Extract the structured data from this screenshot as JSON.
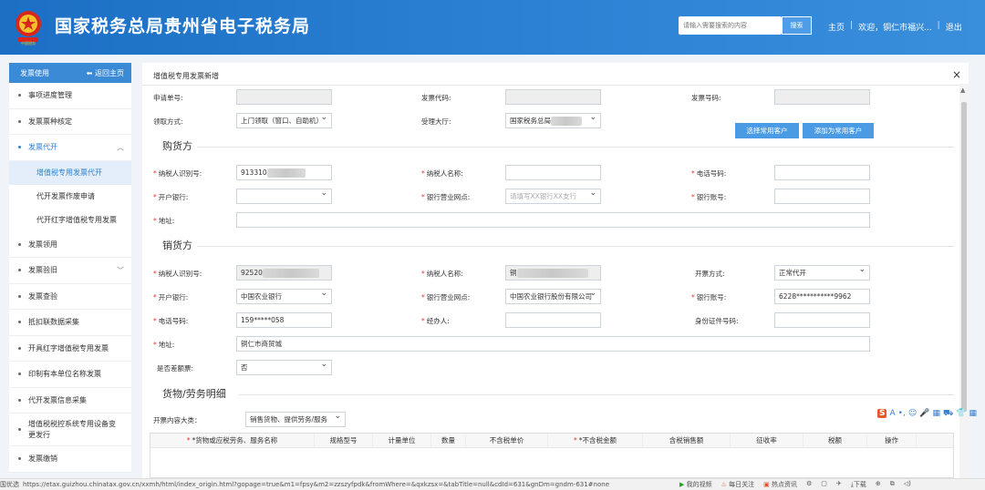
{
  "header": {
    "title": "国家税务总局贵州省电子税务局",
    "search_placeholder": "请输入需要搜索的内容",
    "search_button": "搜索",
    "home": "主页",
    "welcome": "欢迎，铜仁市福兴...",
    "logout": "退出",
    "separator": "|",
    "brand_color": "#2b82d4"
  },
  "sidebar": {
    "title": "发票使用",
    "back": "返回主页",
    "items": [
      {
        "label": "事项进度管理"
      },
      {
        "label": "发票票种核定"
      },
      {
        "label": "发票代开",
        "expanded": true
      },
      {
        "label": "发票领用"
      },
      {
        "label": "发票验旧"
      },
      {
        "label": "发票查验"
      },
      {
        "label": "抵扣联数据采集"
      },
      {
        "label": "开具红字增值税专用发票"
      },
      {
        "label": "印制有本单位名称发票"
      },
      {
        "label": "代开发票信息采集"
      },
      {
        "label": "增值税税控系统专用设备变更发行"
      },
      {
        "label": "发票缴销"
      }
    ],
    "subitems": [
      {
        "label": "增值税专用发票代开"
      },
      {
        "label": "代开发票作废申请"
      },
      {
        "label": "代开红字增值税专用发票"
      }
    ]
  },
  "form": {
    "page_title": "增值税专用发票新增",
    "close": "×",
    "top": {
      "apply_no_label": "申请单号:",
      "invoice_code_label": "发票代码:",
      "invoice_no_label": "发票号码:",
      "collect_method_label": "领取方式:",
      "collect_method_value": "上门领取（窗口、自助机）",
      "hall_label": "受理大厅:",
      "hall_value": "国家税务总局",
      "select_customer_btn": "选择常用客户",
      "add_customer_btn": "添加为常用客户"
    },
    "buyer": {
      "section": "购货方",
      "taxpayer_id_label": "纳税人识别号:",
      "taxpayer_id_value": "913310",
      "taxpayer_name_label": "纳税人名称:",
      "phone_label": "电话号码:",
      "bank_label": "开户银行:",
      "bank_branch_label": "银行营业网点:",
      "bank_branch_placeholder": "请填写XX银行XX支行",
      "account_label": "银行账号:",
      "address_label": "地址:"
    },
    "seller": {
      "section": "销货方",
      "taxpayer_id_label": "纳税人识别号:",
      "taxpayer_id_value": "92520",
      "taxpayer_name_label": "纳税人名称:",
      "taxpayer_name_value": "铜",
      "issue_mode_label": "开票方式:",
      "issue_mode_value": "正常代开",
      "bank_label": "开户银行:",
      "bank_value": "中国农业银行",
      "bank_branch_label": "银行营业网点:",
      "bank_branch_value": "中国农业银行股份有限公司",
      "account_label": "银行账号:",
      "account_value": "6228***********9962",
      "phone_label": "电话号码:",
      "phone_value": "159*****058",
      "agent_label": "经办人:",
      "id_no_label": "身份证件号码:",
      "address_label": "地址:",
      "address_value": "铜仁市商贸城",
      "differential_label": "是否差额票:",
      "differential_value": "否"
    },
    "goods": {
      "section": "货物/劳务明细",
      "category_label": "开票内容大类：",
      "category_value": "销售货物、提供劳务/服务",
      "columns": [
        "*货物或应税劳务、服务名称",
        "规格型号",
        "计量单位",
        "数量",
        "不含税单价",
        "*不含税金额",
        "含税销售额",
        "征收率",
        "税额",
        "操作"
      ]
    }
  },
  "ime": {
    "items": [
      "S",
      "A",
      "•,",
      "☺",
      "🎤",
      "▦",
      "⛟",
      "👕",
      "▦"
    ]
  },
  "statusbar": {
    "prefix": "国优选",
    "url": "https://etax.guizhou.chinatax.gov.cn/xxmh/html/index_origin.html?gopage=true&m1=fpsy&m2=zzszyfpdk&fromWhere=&qxkzsx=&tabTitle=null&cdId=631&gnDm=gndm-631#none",
    "video": "我的视频",
    "follow": "每日关注",
    "hot": "热点资讯",
    "download": "下载"
  }
}
